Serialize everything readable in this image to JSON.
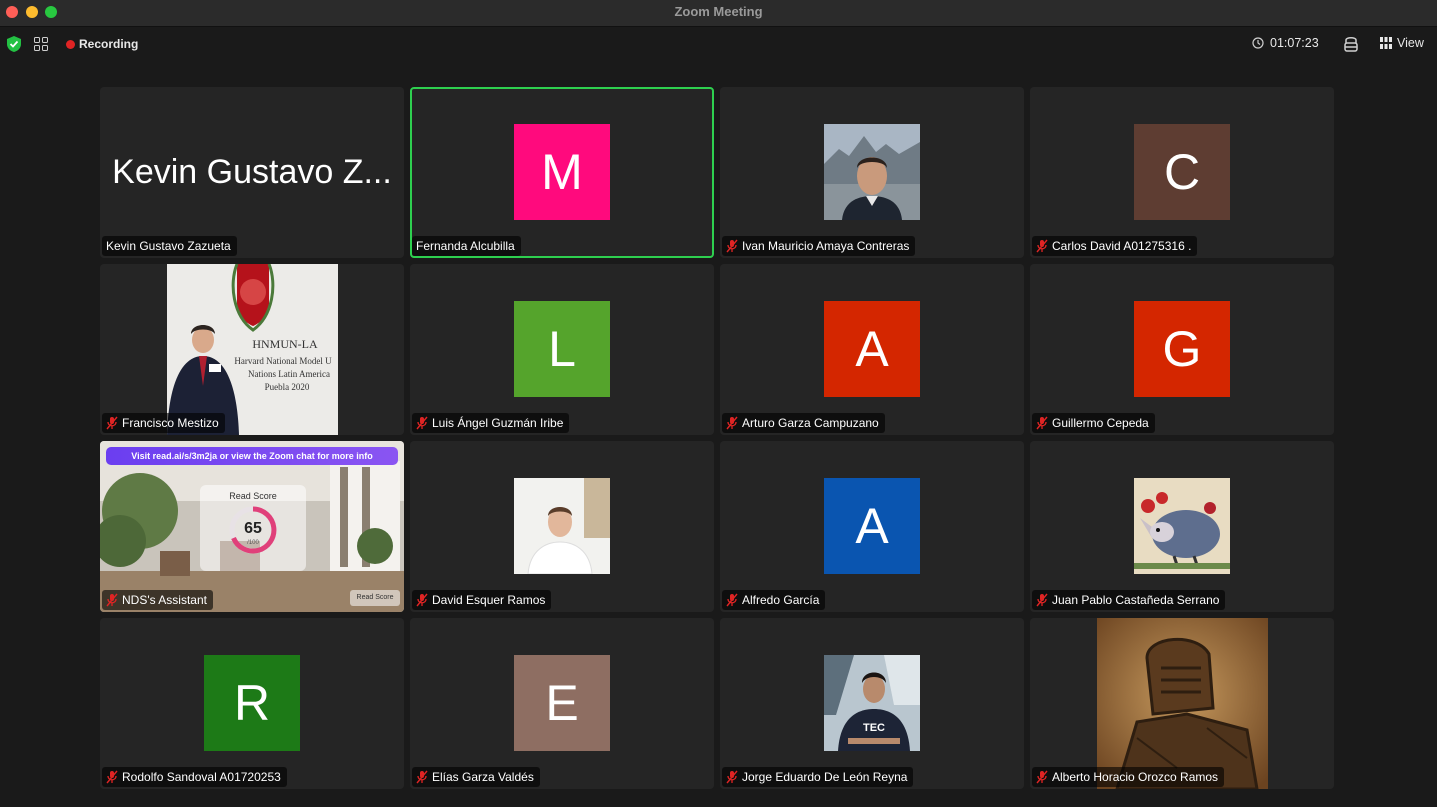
{
  "window": {
    "title": "Zoom Meeting"
  },
  "toolbar": {
    "recording_label": "Recording",
    "timer": "01:07:23",
    "view_label": "View"
  },
  "participants": [
    {
      "name": "Kevin Gustavo Zazueta",
      "display": "Kevin Gustavo Z...",
      "muted": false,
      "type": "name"
    },
    {
      "name": "Fernanda Alcubilla",
      "initial": "M",
      "color": "#ff0a7d",
      "muted": false,
      "active": true,
      "type": "initial"
    },
    {
      "name": "Ivan Mauricio Amaya Contreras",
      "muted": true,
      "type": "photo"
    },
    {
      "name": "Carlos David A01275316 .",
      "initial": "C",
      "color": "#5e3d32",
      "muted": true,
      "type": "initial"
    },
    {
      "name": "Francisco Mestizo",
      "muted": true,
      "type": "photo-large"
    },
    {
      "name": "Luis Ángel Guzmán Iribe",
      "initial": "L",
      "color": "#55a42c",
      "muted": true,
      "type": "initial"
    },
    {
      "name": "Arturo Garza Campuzano",
      "initial": "A",
      "color": "#d42600",
      "muted": true,
      "type": "initial"
    },
    {
      "name": "Guillermo Cepeda",
      "initial": "G",
      "color": "#d42600",
      "muted": true,
      "type": "initial"
    },
    {
      "name": "NDS's Assistant",
      "muted": true,
      "type": "app"
    },
    {
      "name": "David Esquer Ramos",
      "muted": true,
      "type": "photo"
    },
    {
      "name": "Alfredo García",
      "initial": "A",
      "color": "#0a55b0",
      "muted": true,
      "type": "initial"
    },
    {
      "name": "Juan Pablo Castañeda Serrano",
      "muted": true,
      "type": "photo"
    },
    {
      "name": "Rodolfo Sandoval A01720253",
      "initial": "R",
      "color": "#1d7a17",
      "muted": true,
      "type": "initial"
    },
    {
      "name": "Elías Garza Valdés",
      "initial": "E",
      "color": "#8e6e62",
      "muted": true,
      "type": "initial"
    },
    {
      "name": "Jorge Eduardo De León Reyna",
      "muted": true,
      "type": "photo"
    },
    {
      "name": "Alberto Horacio Orozco Ramos",
      "muted": true,
      "type": "photo-large"
    }
  ],
  "francisco_poster": {
    "org": "HNMUN-LA",
    "line1": "Harvard National Model U",
    "line2": "Nations Latin America",
    "line3": "Puebla 2020"
  },
  "nds_app": {
    "banner": "Visit read.ai/s/3m2ja or view the Zoom chat  for more info",
    "score_title": "Read Score",
    "score": "65",
    "score_scale": "/100",
    "button": "Read Score"
  },
  "jorge_shirt": "TEC"
}
